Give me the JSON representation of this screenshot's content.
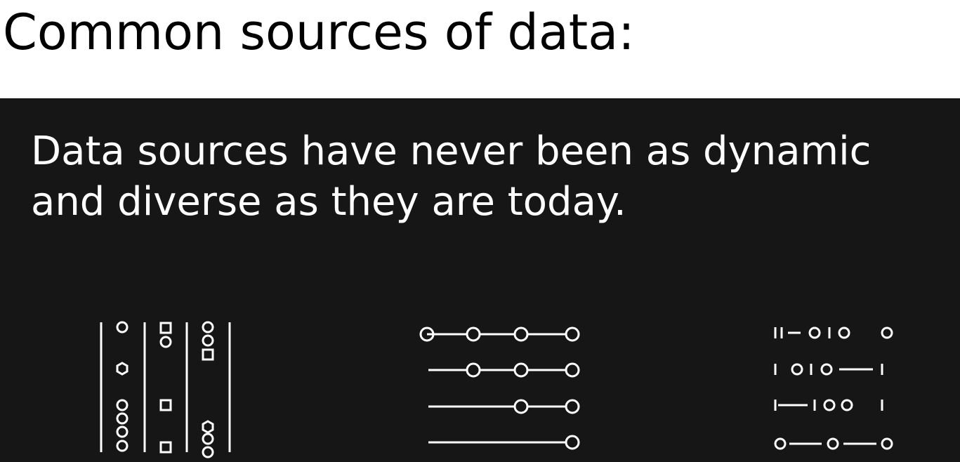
{
  "slide": {
    "title": "Common sources of data:",
    "subtitle_lines": [
      "Data sources have never been as dynamic",
      "and diverse as they are today."
    ]
  },
  "icons": [
    {
      "name": "data-columns-icon"
    },
    {
      "name": "data-timelines-icon"
    },
    {
      "name": "binary-data-icon"
    }
  ],
  "colors": {
    "title_background": "#ffffff",
    "title_text": "#000000",
    "panel_background": "#161616",
    "panel_text": "#ffffff"
  }
}
